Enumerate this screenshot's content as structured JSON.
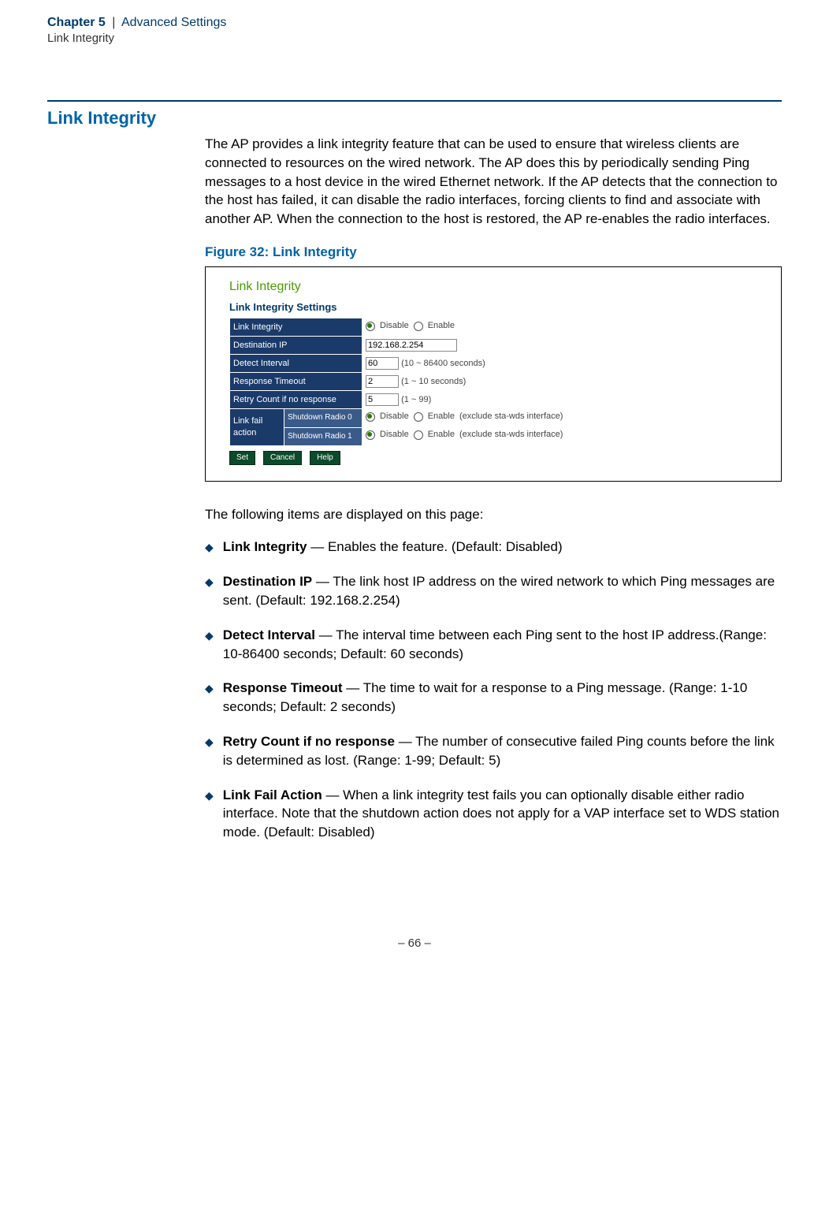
{
  "header": {
    "chapter": "Chapter 5",
    "subject": "Advanced Settings",
    "subhead": "Link Integrity"
  },
  "section_title": "Link Integrity",
  "intro": "The AP provides a link integrity feature that can be used to ensure that wireless clients are connected to resources on the wired network. The AP does this by periodically sending Ping messages to a host device in the wired Ethernet network. If the AP detects that the connection to the host has failed, it can disable the radio interfaces, forcing clients to find and associate with another AP. When the connection to the host is restored, the AP re-enables the radio interfaces.",
  "figure": {
    "caption": "Figure 32:  Link Integrity",
    "title": "Link Integrity",
    "subtitle": "Link Integrity Settings",
    "rows": {
      "r0": {
        "label": "Link Integrity",
        "disable": "Disable",
        "enable": "Enable"
      },
      "r1": {
        "label": "Destination IP",
        "value": "192.168.2.254"
      },
      "r2": {
        "label": "Detect Interval",
        "value": "60",
        "hint": "(10 ~ 86400 seconds)"
      },
      "r3": {
        "label": "Response Timeout",
        "value": "2",
        "hint": "(1 ~ 10 seconds)"
      },
      "r4": {
        "label": "Retry Count if no response",
        "value": "5",
        "hint": "(1 ~ 99)"
      },
      "r5": {
        "label": "Link fail action",
        "sub0": "Shutdown Radio 0",
        "sub1": "Shutdown Radio 1",
        "disable": "Disable",
        "enable": "Enable",
        "note": "(exclude sta-wds interface)"
      }
    },
    "buttons": {
      "set": "Set",
      "cancel": "Cancel",
      "help": "Help"
    }
  },
  "list_intro": "The following items are displayed on this page:",
  "items": [
    {
      "title": "Link Integrity",
      "desc": " — Enables the feature. (Default: Disabled)"
    },
    {
      "title": "Destination IP",
      "desc": " — The link host IP address on the wired network to which Ping messages are sent. (Default: 192.168.2.254)"
    },
    {
      "title": "Detect Interval",
      "desc": " — The interval time between each Ping sent to the host IP address.(Range: 10-86400 seconds; Default: 60 seconds)"
    },
    {
      "title": "Response Timeout",
      "desc": " — The time to wait for a response to a Ping message. (Range: 1-10 seconds; Default: 2 seconds)"
    },
    {
      "title": "Retry Count if no response",
      "desc": " — The number of consecutive failed Ping counts before the link is determined as lost. (Range: 1-99; Default: 5)"
    },
    {
      "title": "Link Fail Action",
      "desc": " — When a link integrity test fails you can optionally disable either radio interface. Note that the shutdown action does not apply for a VAP interface set to WDS station mode. (Default: Disabled)"
    }
  ],
  "footer": "–  66  –"
}
